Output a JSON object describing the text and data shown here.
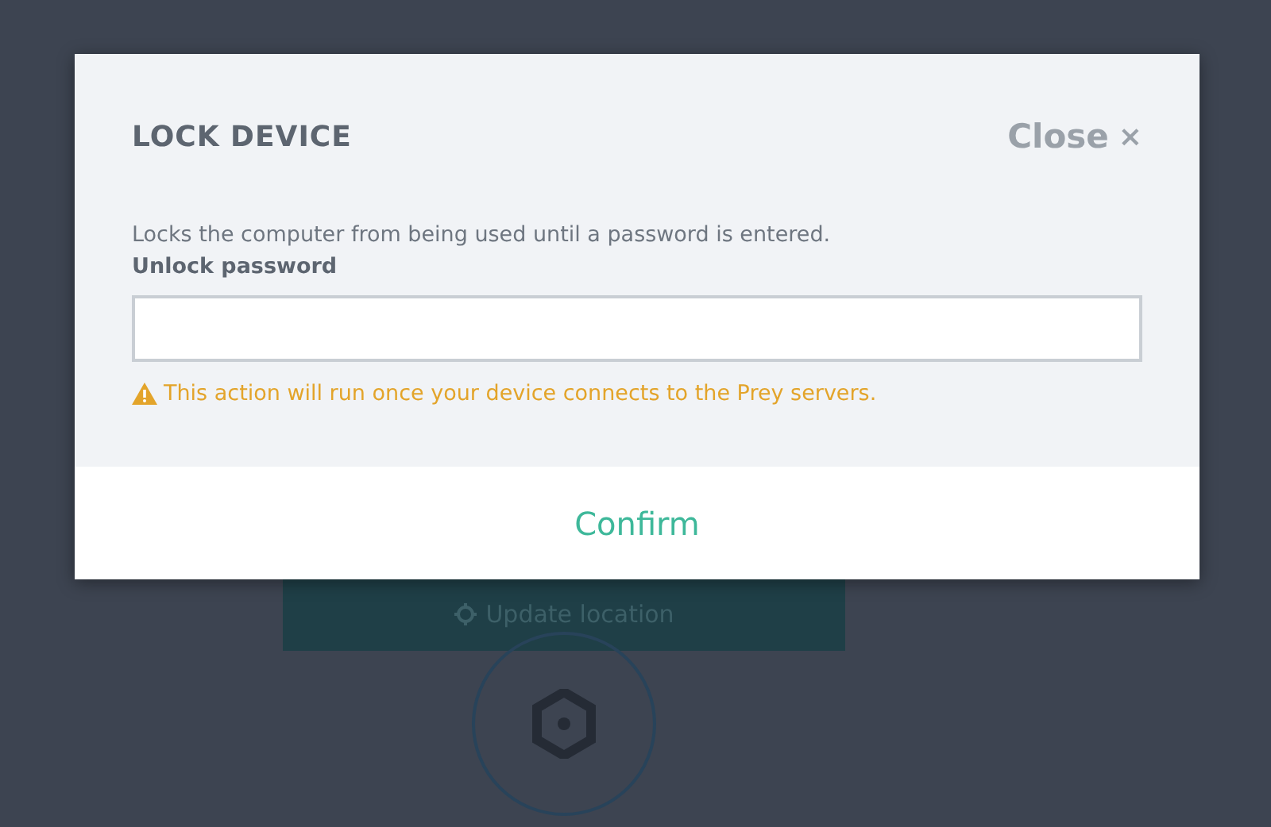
{
  "background": {
    "update_button": "Update location"
  },
  "modal": {
    "title": "LOCK DEVICE",
    "close_label": "Close",
    "close_glyph": "×",
    "description": "Locks the computer from being used until a password is entered.",
    "field_label": "Unlock password",
    "warning": "This action will run once your device connects to the Prey servers.",
    "confirm_label": "Confirm"
  }
}
